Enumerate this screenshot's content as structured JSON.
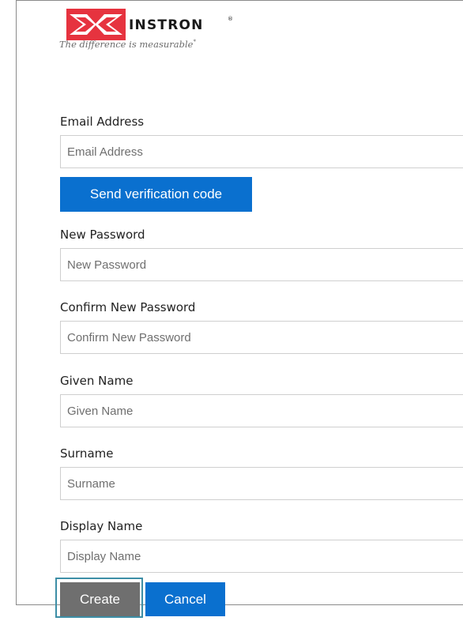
{
  "brand": {
    "wordmark": "INSTRON",
    "registered": "®",
    "tagline": "The difference is measurable",
    "tagline_mark": "*",
    "colors": {
      "mark_red": "#e6333f",
      "text_dark": "#1a1a1a"
    }
  },
  "form": {
    "email": {
      "label": "Email Address",
      "placeholder": "Email Address",
      "value": ""
    },
    "send_code_label": "Send verification code",
    "new_password": {
      "label": "New Password",
      "placeholder": "New Password",
      "value": ""
    },
    "confirm_password": {
      "label": "Confirm New Password",
      "placeholder": "Confirm New Password",
      "value": ""
    },
    "given_name": {
      "label": "Given Name",
      "placeholder": "Given Name",
      "value": ""
    },
    "surname": {
      "label": "Surname",
      "placeholder": "Surname",
      "value": ""
    },
    "display_name": {
      "label": "Display Name",
      "placeholder": "Display Name",
      "value": ""
    }
  },
  "actions": {
    "create_label": "Create",
    "cancel_label": "Cancel",
    "colors": {
      "primary": "#0a70cf",
      "create_bg": "#6f6f6f",
      "focus_ring": "#3d8ea6"
    }
  }
}
